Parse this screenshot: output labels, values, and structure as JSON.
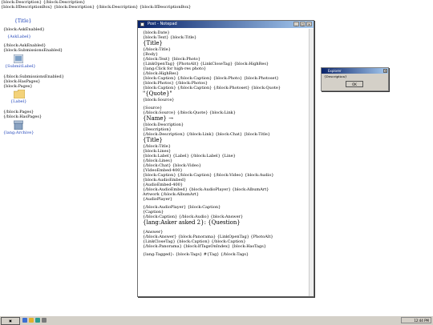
{
  "top_lines": [
    "{block:Description} {/block:Description}",
    "{block:IfDescriptionBox} {block:Description} {/block:Description} {block:IfDescriptionBox}"
  ],
  "left_title": "{Title}",
  "left_lines": [
    "{block:AskEnabled}",
    "{AskLabel}",
    "{/block:AskEnabled}",
    "{block:SubmissionsEnabled}",
    "{SubmitLabel}",
    "{/block:SubmissionsEnabled}",
    "{block:HasPages}",
    "{block:Pages}",
    "{Label}",
    "{/block:Pages}",
    "{/block:HasPages}",
    "{lang:Archive}"
  ],
  "notepad": {
    "title": "Post - Notepad",
    "lines": [
      "{block:Date}",
      "{block:Text} {block:Title}",
      "{Title}",
      "{/block:Title}",
      "{Body}",
      "{/block:Text} {block:Photo}",
      "{LinkOpenTag} {PhotoAlt} {LinkCloseTag} {block:HighRes}",
      "{lang:Click for high-res photo}",
      "{/block:HighRes}",
      "{block:Caption} {/block:Caption} {block:Photo} {block:Photoset}",
      "{block:Photos} {/block:Photos}",
      "{block:Caption} {/block:Caption} {/block:Photoset} {block:Quote}",
      "\"{Quote}\"",
      "{block:Source}",
      "{Source}",
      "{/block:Source} {/block:Quote} {block:Link}",
      "{Name} →",
      "{block:Description}",
      "{Description}",
      "{/block:Description} {/block:Link} {block:Chat} {block:Title}",
      "{Title}",
      "{/block:Title}",
      "{block:Lines}",
      "{block:Label} {Label} {/block:Label} {Line}",
      "{/block:Lines}",
      "{/block:Chat} {block:Video}",
      "{VideoEmbed-400}",
      "{block:Caption} {/block:Caption} {/block:Video} {block:Audio}",
      "{block:AudioEmbed}",
      "{AudioEmbed-400}",
      "{/block:AudioEmbed} {block:AudioPlayer} {block:AlbumArt}",
      "Artwork {/block:AlbumArt}",
      "{AudioPlayer}",
      "{/block:AudioPlayer} {block:Caption}",
      "{Caption}",
      "{/block:Caption} {/block:Audio} {block:Answer}",
      "{lang:Asker asked 2}: {Question}",
      "{Answer}",
      "{/block:Answer} {block:Panorama} {LinkOpenTag} {PhotoAlt}",
      "{LinkCloseTag} {block:Caption} {/block:Caption}",
      "{/block:Panorama} {block:IfTagsOnIndex} {block:HasTags}",
      "{lang:Tagged}: {block:Tags} #{Tag} {/block:Tags}"
    ]
  },
  "dialog": {
    "title": "Explorer",
    "text": "{Description}",
    "ok_label": "OK"
  },
  "taskbar": {
    "clock": "12:44 PM"
  }
}
